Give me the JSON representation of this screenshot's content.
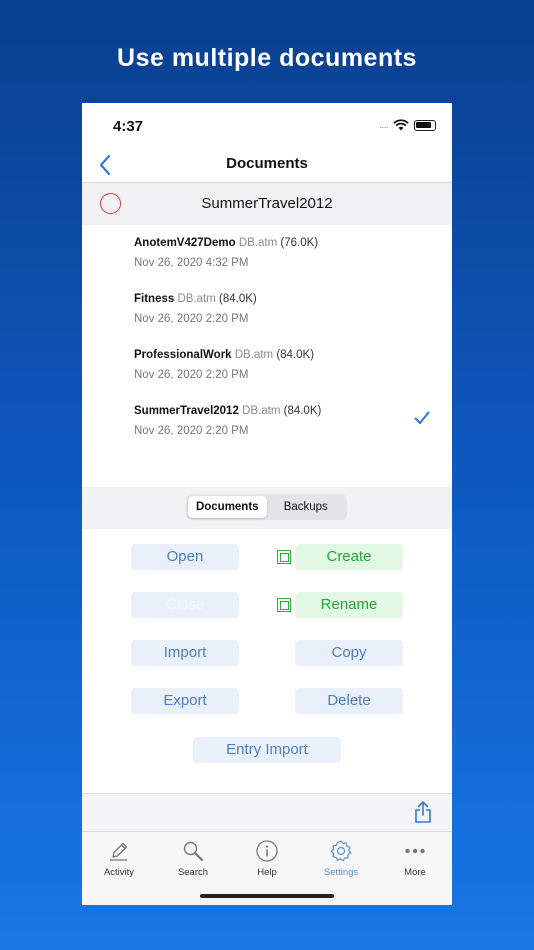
{
  "headline": "Use multiple documents",
  "status_bar": {
    "time": "4:37",
    "signal": "....."
  },
  "nav": {
    "title": "Documents"
  },
  "current_document": "SummerTravel2012",
  "documents": [
    {
      "name": "AnotemV427Demo",
      "ext": "DB.atm",
      "size": "(76.0K)",
      "date": "Nov 26, 2020 4:32 PM",
      "selected": false
    },
    {
      "name": "Fitness",
      "ext": "DB.atm",
      "size": "(84.0K)",
      "date": "Nov 26, 2020 2:20 PM",
      "selected": false
    },
    {
      "name": "ProfessionalWork",
      "ext": "DB.atm",
      "size": "(84.0K)",
      "date": "Nov 26, 2020 2:20 PM",
      "selected": false
    },
    {
      "name": "SummerTravel2012",
      "ext": "DB.atm",
      "size": "(84.0K)",
      "date": "Nov 26, 2020 2:20 PM",
      "selected": true
    }
  ],
  "segmented": {
    "documents": "Documents",
    "backups": "Backups",
    "selected": "Documents"
  },
  "actions": {
    "open": "Open",
    "create": "Create",
    "close": "Close",
    "rename": "Rename",
    "import": "Import",
    "copy": "Copy",
    "export": "Export",
    "delete": "Delete",
    "entry_import": "Entry Import"
  },
  "tabs": [
    {
      "label": "Activity",
      "icon": "pencil-icon"
    },
    {
      "label": "Search",
      "icon": "magnifier-icon"
    },
    {
      "label": "Help",
      "icon": "info-icon"
    },
    {
      "label": "Settings",
      "icon": "gear-icon"
    },
    {
      "label": "More",
      "icon": "ellipsis-icon"
    }
  ],
  "active_tab": "Settings",
  "colors": {
    "accent": "#3478d6",
    "green": "#22a834",
    "danger": "#d9363e"
  }
}
